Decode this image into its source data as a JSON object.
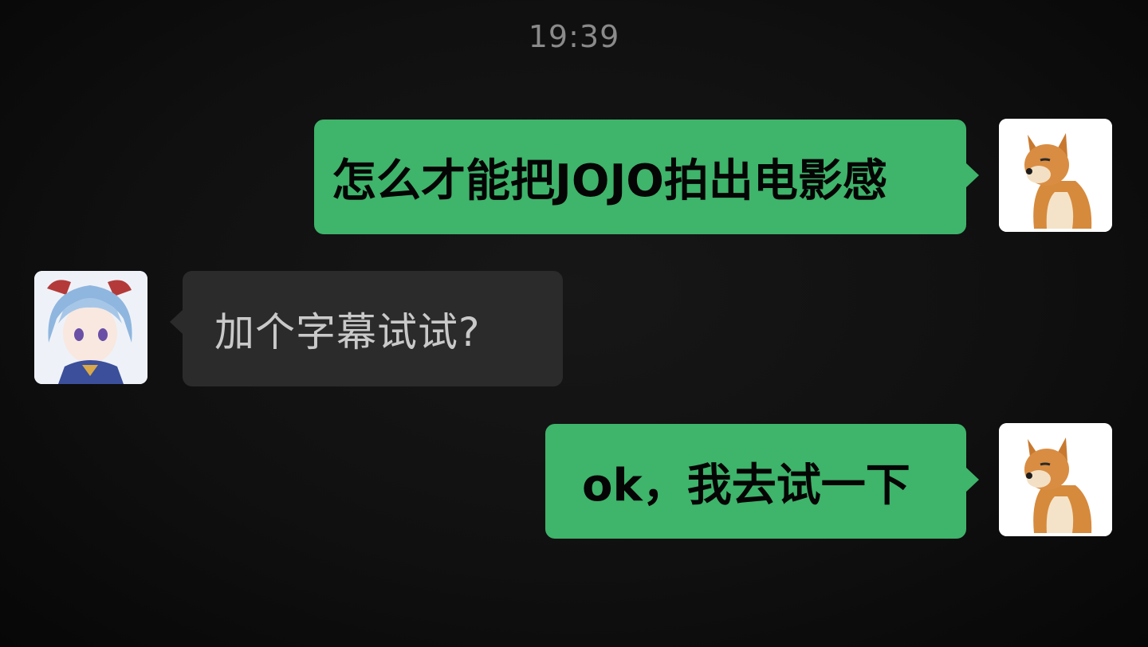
{
  "chat": {
    "timestamp": "19:39",
    "messages": [
      {
        "direction": "outgoing",
        "text": "怎么才能把JOJO拍出电影感",
        "avatar_icon": "shiba-dog-avatar-icon"
      },
      {
        "direction": "incoming",
        "text": "加个字幕试试?",
        "avatar_icon": "anime-girl-avatar-icon"
      },
      {
        "direction": "outgoing",
        "text": "ok，我去试一下",
        "avatar_icon": "shiba-dog-avatar-icon"
      }
    ]
  },
  "colors": {
    "background": "#111111",
    "outgoing_bubble": "#3fb46b",
    "incoming_bubble": "#2b2b2b",
    "timestamp_text": "#8a8a8a",
    "incoming_text": "#c9c9c9"
  }
}
